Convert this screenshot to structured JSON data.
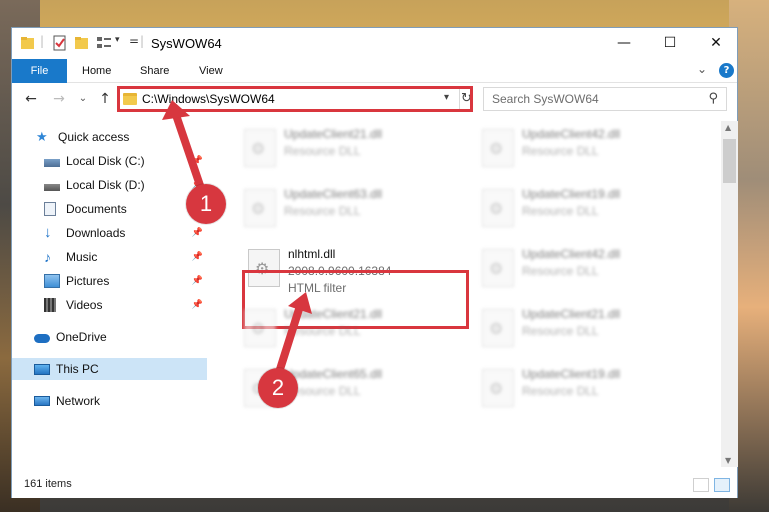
{
  "window": {
    "title": "SysWOW64",
    "controls": {
      "minimize": "—",
      "maximize": "☐",
      "close": "✕"
    }
  },
  "ribbon": {
    "tabs": [
      "File",
      "Home",
      "Share",
      "View"
    ],
    "expand_chevron": "⌄",
    "help": "?"
  },
  "navigation": {
    "back": "←",
    "forward": "→",
    "recent": "⌄",
    "up": "↑",
    "address_path": "C:\\Windows\\SysWOW64",
    "search_placeholder": "Search SysWOW64"
  },
  "sidebar": {
    "items": [
      {
        "label": "Quick access",
        "icon": "star-icon"
      },
      {
        "label": "Local Disk (C:)",
        "icon": "drive-icon"
      },
      {
        "label": "Local Disk (D:)",
        "icon": "drive-icon"
      },
      {
        "label": "Documents",
        "icon": "document-icon"
      },
      {
        "label": "Downloads",
        "icon": "download-icon"
      },
      {
        "label": "Music",
        "icon": "music-icon"
      },
      {
        "label": "Pictures",
        "icon": "pictures-icon"
      },
      {
        "label": "Videos",
        "icon": "videos-icon"
      },
      {
        "label": "OneDrive",
        "icon": "cloud-icon"
      },
      {
        "label": "This PC",
        "icon": "pc-icon",
        "selected": true
      },
      {
        "label": "Network",
        "icon": "network-icon"
      }
    ]
  },
  "files": [
    {
      "name": "UpdateClient21.dll",
      "meta": "Resource DLL"
    },
    {
      "name": "UpdateClient42.dll",
      "meta": "Resource DLL"
    },
    {
      "name": "UpdateClient63.dll",
      "meta": "Resource DLL"
    },
    {
      "name": "UpdateClient19.dll",
      "meta": "Resource DLL"
    },
    {
      "name": "nlhtml.dll",
      "meta": "2008.0.9600.16384",
      "meta2": "HTML filter",
      "highlighted": true
    },
    {
      "name": "UpdateClient42.dll",
      "meta": "Resource DLL"
    },
    {
      "name": "UpdateClient21.dll",
      "meta": "Resource DLL"
    },
    {
      "name": "UpdateClient21.dll",
      "meta": "Resource DLL"
    },
    {
      "name": "UpdateClient65.dll",
      "meta": "Resource DLL"
    },
    {
      "name": "UpdateClient19.dll",
      "meta": "Resource DLL"
    }
  ],
  "status": {
    "item_count": "161 items"
  },
  "annotations": {
    "step1": "1",
    "step2": "2"
  },
  "colors": {
    "accent": "#1979ca",
    "highlight": "#d9363e",
    "selected": "#cce4f7"
  }
}
